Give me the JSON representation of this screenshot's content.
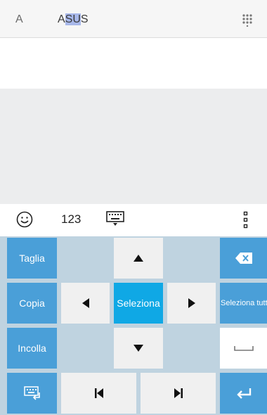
{
  "topbar": {
    "font_label": "A",
    "brand_prefix": "A",
    "brand_selected": "SU",
    "brand_suffix": "S"
  },
  "toolbar": {
    "number_label": "123"
  },
  "keys": {
    "cut": "Taglia",
    "copy": "Copia",
    "paste": "Incolla",
    "select": "Seleziona",
    "select_all": "Seleziona tutto"
  },
  "colors": {
    "blue_key": "#4a9fd8",
    "select_key": "#0fa8e5",
    "keyboard_bg": "#bfd3e0",
    "selection_highlight": "#a8b8ea"
  }
}
